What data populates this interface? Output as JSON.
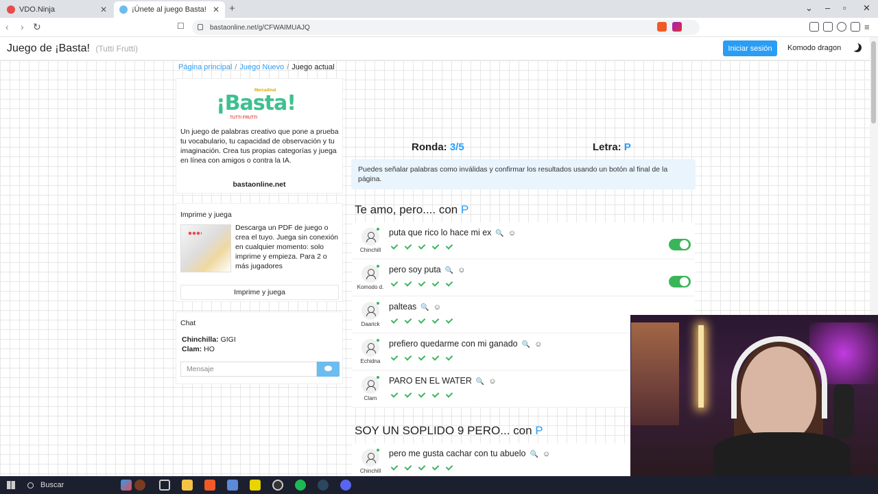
{
  "browser": {
    "tabs": [
      {
        "title": "VDO.Ninja"
      },
      {
        "title": "¡Únete al juego Basta!"
      }
    ],
    "url": "bastaonline.net/g/CFWAIMUAJQ"
  },
  "header": {
    "title": "Juego de ¡Basta!",
    "subtitle": "(Tutti Frutti)",
    "login_label": "Iniciar sesión",
    "username": "Komodo dragon"
  },
  "breadcrumb": {
    "home": "Página principal",
    "new_game": "Juego Nuevo",
    "current": "Juego actual"
  },
  "about": {
    "logo_top": "Mercadinal",
    "logo_main": "¡Basta!",
    "logo_sub": "TUTTI FRUTTI",
    "description": "Un juego de palabras creativo que pone a prueba tu vocabulario, tu capacidad de observación y tu imaginación. Crea tus propias categorías y juega en línea con amigos o contra la IA.",
    "site": "bastaonline.net"
  },
  "print": {
    "title": "Imprime y juega",
    "text": "Descarga un PDF de juego o crea el tuyo. Juega sin conexión en cualquier momento: solo imprime y empieza. Para 2 o más jugadores",
    "button": "Imprime y juega"
  },
  "chat": {
    "title": "Chat",
    "messages": [
      {
        "user": "Chinchilla:",
        "text": "GIGI"
      },
      {
        "user": "Clam:",
        "text": "HO"
      }
    ],
    "placeholder": "Mensaje"
  },
  "game": {
    "round_label": "Ronda:",
    "round_value": "3/5",
    "letter_label": "Letra:",
    "letter_value": "P",
    "notice": "Puedes señalar palabras como inválidas y confirmar los resultados usando un botón al final de la página.",
    "categories": [
      {
        "name": "Te amo, pero.... con",
        "letter": "P",
        "answers": [
          {
            "player": "Chinchill",
            "word": "puta que rico lo hace mi ex",
            "toggle": true
          },
          {
            "player": "Komodo d.",
            "word": "pero soy puta",
            "toggle": true
          },
          {
            "player": "Daarick",
            "word": "palteas",
            "toggle": false
          },
          {
            "player": "Echidna",
            "word": "prefiero quedarme con mi ganado",
            "toggle": false
          },
          {
            "player": "Clam",
            "word": "PARO EN EL WATER",
            "toggle": false
          }
        ]
      },
      {
        "name": "SOY UN SOPLIDO 9 PERO... con",
        "letter": "P",
        "answers": [
          {
            "player": "Chinchill",
            "word": "pero me gusta cachar con tu abuelo",
            "toggle": false
          }
        ]
      }
    ]
  },
  "taskbar": {
    "search": "Buscar"
  },
  "colors": {
    "accent": "#2a9df4",
    "success": "#3bb55a",
    "logo": "#3ec08f"
  }
}
